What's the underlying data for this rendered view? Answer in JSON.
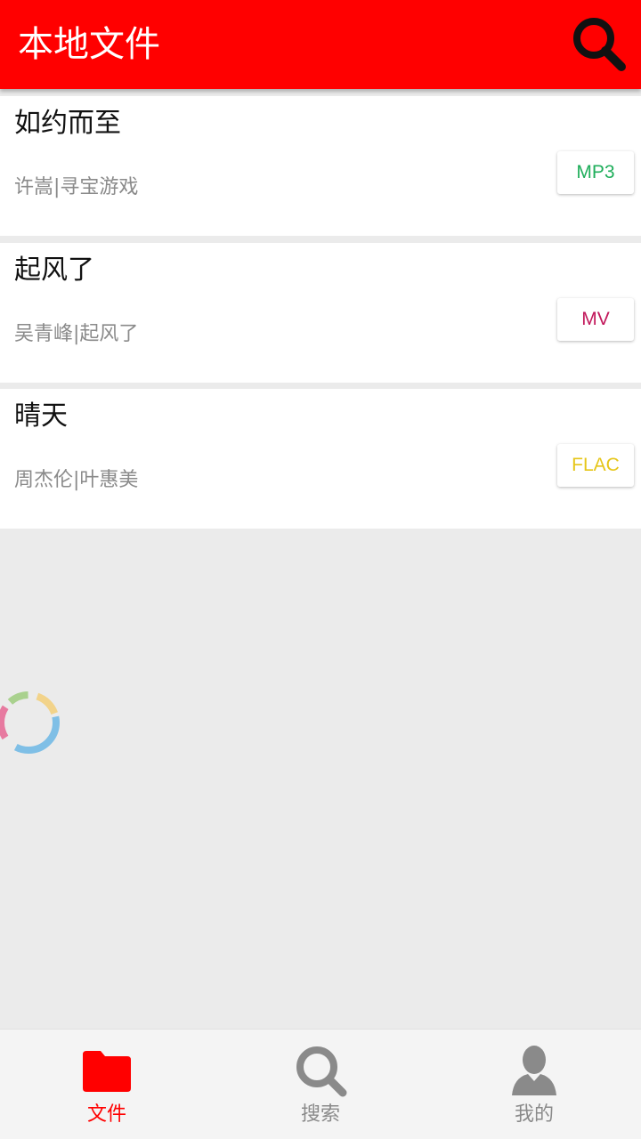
{
  "appbar": {
    "title": "本地文件"
  },
  "items": [
    {
      "title": "如约而至",
      "subtitle": "许嵩|寻宝游戏",
      "badge": "MP3",
      "badge_color": "#1fae5b"
    },
    {
      "title": "起风了",
      "subtitle": "吴青峰|起风了",
      "badge": "MV",
      "badge_color": "#c2185b"
    },
    {
      "title": "晴天",
      "subtitle": "周杰伦|叶惠美",
      "badge": "FLAC",
      "badge_color": "#e6c619"
    }
  ],
  "tabs": [
    {
      "label": "文件",
      "icon": "folder-icon",
      "active": true
    },
    {
      "label": "搜索",
      "icon": "search-icon",
      "active": false
    },
    {
      "label": "我的",
      "icon": "user-icon",
      "active": false
    }
  ],
  "colors": {
    "accent": "#ff0000",
    "background": "#ebebeb",
    "tab_inactive": "#8a8a8a"
  }
}
